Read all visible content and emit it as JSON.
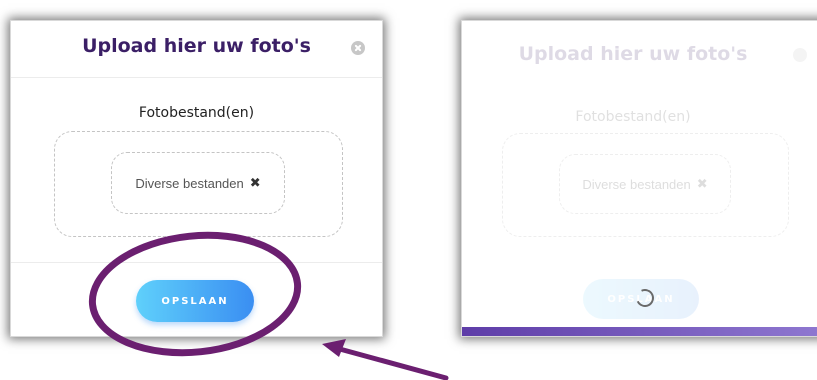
{
  "left_dialog": {
    "title": "Upload hier uw foto's",
    "close_icon": "close-circle-icon",
    "section_label": "Fotobestand(en)",
    "file_chip": {
      "label": "Diverse bestanden",
      "remove_glyph": "✖"
    },
    "save_button_label": "OPSLAAN"
  },
  "right_dialog": {
    "title": "Upload hier uw foto's",
    "close_icon": "close-circle-icon",
    "section_label": "Fotobestand(en)",
    "file_chip": {
      "label": "Diverse bestanden",
      "remove_glyph": "✖"
    },
    "save_button_label": "OPSLAAN",
    "loading_icon": "spinner-icon",
    "upload_progress": 0.97
  },
  "annotations": {
    "highlight_shape": "ellipse",
    "pointer_shape": "arrow",
    "color": "#6b1f70"
  },
  "colors": {
    "title": "#3b1f66",
    "button_gradient_start": "#5fd0fb",
    "button_gradient_end": "#3a8ef2",
    "progress_fill": "#5e3da8",
    "annotation": "#6b1f70"
  }
}
